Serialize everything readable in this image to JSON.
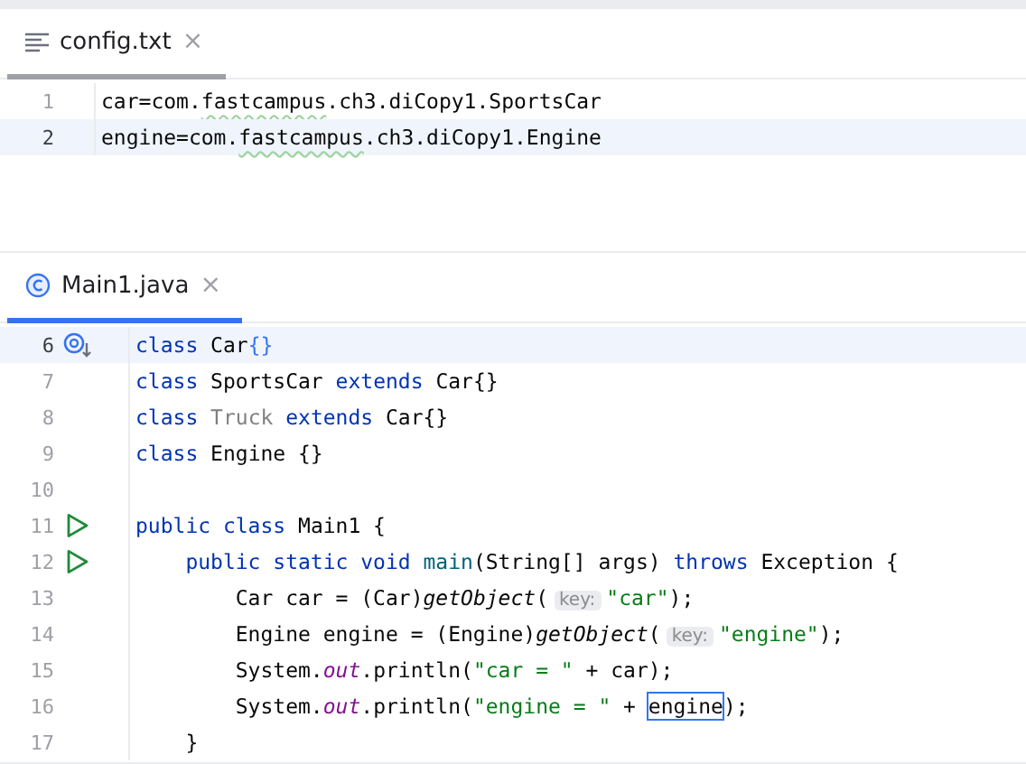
{
  "panes": [
    {
      "tab": {
        "label": "config.txt",
        "kind": "text",
        "selected": true,
        "focused": false,
        "close": "×"
      },
      "lines": [
        {
          "number": "1",
          "current": false,
          "tokens": [
            {
              "text": "car=com.",
              "kind": "plain"
            },
            {
              "text": "fastcampus",
              "kind": "typo"
            },
            {
              "text": ".ch3.diCopy1.SportsCar",
              "kind": "plain"
            }
          ]
        },
        {
          "number": "2",
          "current": true,
          "tokens": [
            {
              "text": "engine=com.",
              "kind": "plain"
            },
            {
              "text": "fastcampus",
              "kind": "typo"
            },
            {
              "text": ".ch3.diCopy1.Engine",
              "kind": "plain"
            }
          ]
        }
      ]
    },
    {
      "tab": {
        "label": "Main1.java",
        "kind": "class",
        "selected": true,
        "focused": true,
        "close": "×"
      },
      "lines": [
        {
          "number": "6",
          "current": true,
          "gutter": {
            "kind": "implemented"
          },
          "tokens": [
            {
              "text": "class ",
              "kind": "keyword"
            },
            {
              "text": "Car",
              "kind": "plain"
            },
            {
              "text": "{}",
              "kind": "brace"
            }
          ]
        },
        {
          "number": "7",
          "current": false,
          "tokens": [
            {
              "text": "class ",
              "kind": "keyword"
            },
            {
              "text": "SportsCar ",
              "kind": "plain"
            },
            {
              "text": "extends ",
              "kind": "keyword"
            },
            {
              "text": "Car{}",
              "kind": "plain"
            }
          ]
        },
        {
          "number": "8",
          "current": false,
          "tokens": [
            {
              "text": "class ",
              "kind": "keyword"
            },
            {
              "text": "Truck ",
              "kind": "unused"
            },
            {
              "text": "extends ",
              "kind": "keyword"
            },
            {
              "text": "Car{}",
              "kind": "plain"
            }
          ]
        },
        {
          "number": "9",
          "current": false,
          "tokens": [
            {
              "text": "class ",
              "kind": "keyword"
            },
            {
              "text": "Engine {}",
              "kind": "plain"
            }
          ]
        },
        {
          "number": "10",
          "current": false
        },
        {
          "number": "11",
          "current": false,
          "gutter": {
            "kind": "run"
          },
          "tokens": [
            {
              "text": "public class ",
              "kind": "keyword"
            },
            {
              "text": "Main1 {",
              "kind": "plain"
            }
          ]
        },
        {
          "number": "12",
          "current": false,
          "gutter": {
            "kind": "run"
          },
          "tokens": [
            {
              "text": "    public static void ",
              "kind": "keyword"
            },
            {
              "text": "main",
              "kind": "method"
            },
            {
              "text": "(String[] args) ",
              "kind": "plain"
            },
            {
              "text": "throws ",
              "kind": "keyword"
            },
            {
              "text": "Exception {",
              "kind": "plain"
            }
          ]
        },
        {
          "number": "13",
          "current": false,
          "tokens": [
            {
              "text": "        Car car = (Car)",
              "kind": "plain"
            },
            {
              "text": "getObject",
              "kind": "italic"
            },
            {
              "text": "(",
              "kind": "plain"
            },
            {
              "text": "key:",
              "kind": "hint"
            },
            {
              "text": "\"car\"",
              "kind": "string"
            },
            {
              "text": ");",
              "kind": "plain"
            }
          ]
        },
        {
          "number": "14",
          "current": false,
          "tokens": [
            {
              "text": "        Engine engine = (Engine)",
              "kind": "plain"
            },
            {
              "text": "getObject",
              "kind": "italic"
            },
            {
              "text": "(",
              "kind": "plain"
            },
            {
              "text": "key:",
              "kind": "hint"
            },
            {
              "text": "\"engine\"",
              "kind": "string"
            },
            {
              "text": ");",
              "kind": "plain"
            }
          ]
        },
        {
          "number": "15",
          "current": false,
          "tokens": [
            {
              "text": "        System.",
              "kind": "plain"
            },
            {
              "text": "out",
              "kind": "field"
            },
            {
              "text": ".println(",
              "kind": "plain"
            },
            {
              "text": "\"car = \"",
              "kind": "string"
            },
            {
              "text": " + car);",
              "kind": "plain"
            }
          ]
        },
        {
          "number": "16",
          "current": false,
          "tokens": [
            {
              "text": "        System.",
              "kind": "plain"
            },
            {
              "text": "out",
              "kind": "field"
            },
            {
              "text": ".println(",
              "kind": "plain"
            },
            {
              "text": "\"engine = \"",
              "kind": "string"
            },
            {
              "text": " + ",
              "kind": "plain"
            },
            {
              "text": "engine",
              "kind": "boxed"
            },
            {
              "text": ");",
              "kind": "plain"
            }
          ]
        },
        {
          "number": "17",
          "current": false,
          "tokens": [
            {
              "text": "    }",
              "kind": "plain"
            }
          ]
        }
      ]
    }
  ]
}
